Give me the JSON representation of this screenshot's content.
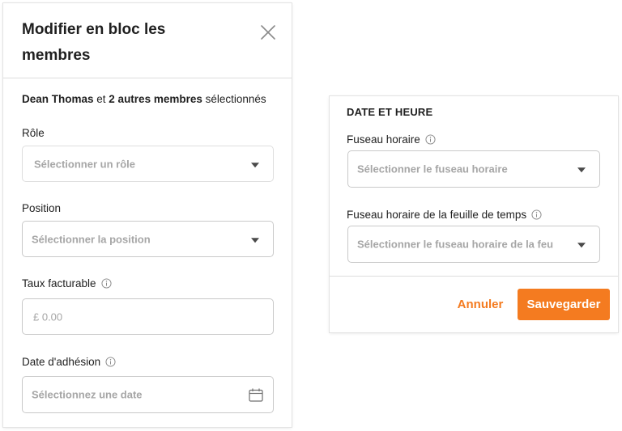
{
  "left_panel": {
    "title": "Modifier en bloc les membres",
    "close_icon": "close-icon",
    "selected": {
      "name": "Dean Thomas",
      "connector": " et ",
      "count_text": "2 autres membres",
      "suffix": " sélectionnés"
    },
    "role": {
      "label": "Rôle",
      "placeholder": "Sélectionner un rôle"
    },
    "position": {
      "label": "Position",
      "placeholder": "Sélectionner la position"
    },
    "billable_rate": {
      "label": "Taux facturable",
      "placeholder": "£ 0.00"
    },
    "join_date": {
      "label": "Date d'adhésion",
      "placeholder": "Sélectionnez une date"
    }
  },
  "right_panel": {
    "section_title": "DATE ET HEURE",
    "timezone": {
      "label": "Fuseau horaire",
      "placeholder": "Sélectionner le fuseau horaire"
    },
    "timesheet_timezone": {
      "label": "Fuseau horaire de la feuille de temps",
      "placeholder": "Sélectionner le fuseau horaire de la feu"
    },
    "cancel_label": "Annuler",
    "save_label": "Sauvegarder"
  },
  "colors": {
    "accent": "#f47b20",
    "border": "#c9c9c9",
    "placeholder": "#a6a6a6"
  }
}
